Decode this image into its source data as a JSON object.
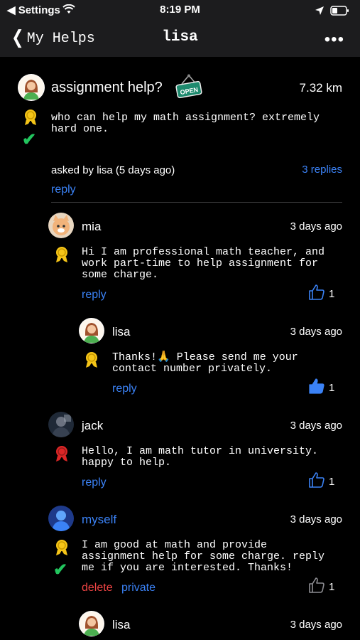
{
  "status_bar": {
    "back_app": "◀ Settings",
    "time": "8:19 PM"
  },
  "nav": {
    "back_label": "My Helps",
    "title": "lisa",
    "more_label": "•••"
  },
  "question": {
    "title": "assignment help?",
    "badge": "OPEN",
    "distance": "7.32 km",
    "body": "who can help my math assignment? extremely\nhard one.",
    "asked_by": "asked by lisa (5 days ago)",
    "replies": "3 replies",
    "reply_label": "reply"
  },
  "replies": [
    {
      "name": "mia",
      "time": "3 days ago",
      "body": "Hi I am professional math teacher, and\nwork part-time to help assignment for\nsome charge.",
      "reply_label": "reply",
      "likes": "1",
      "medal_color": "#f5c518",
      "liked": false
    },
    {
      "name": "lisa",
      "time": "3 days ago",
      "body": "Thanks!🙏 Please send me your\ncontact number privately.",
      "reply_label": "reply",
      "likes": "1",
      "medal_color": "#f5c518",
      "liked": true
    },
    {
      "name": "jack",
      "time": "3 days ago",
      "body": "Hello, I am math tutor in university.\nhappy to help.",
      "reply_label": "reply",
      "likes": "1",
      "medal_color": "#dc2626",
      "liked": false
    },
    {
      "name": "myself",
      "time": "3 days ago",
      "body": "I am good at math and provide\nassignment help for some charge. reply\nme if you are interested. Thanks!",
      "delete_label": "delete",
      "private_label": "private",
      "likes": "1",
      "medal_color": "#f5c518",
      "liked": false
    },
    {
      "name": "lisa",
      "time": "3 days ago"
    }
  ],
  "colors": {
    "accent": "#3b82f6",
    "check": "#22c55e",
    "delete": "#ef4444"
  }
}
